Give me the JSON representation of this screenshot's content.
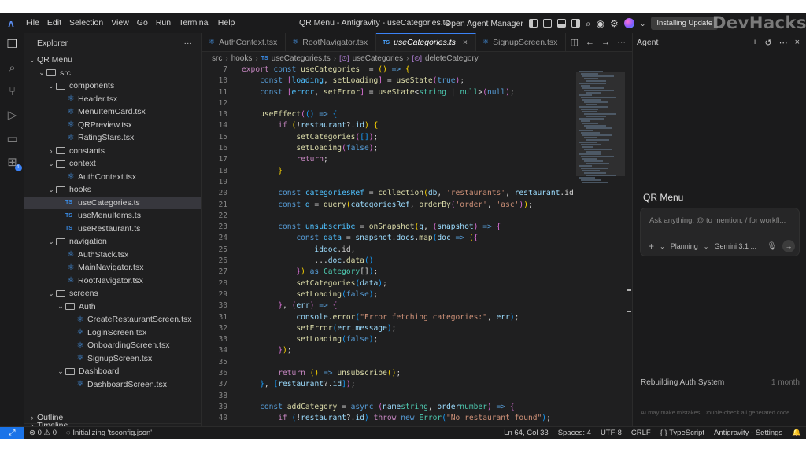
{
  "window": {
    "title": "QR Menu - Antigravity - useCategories.ts",
    "menu": [
      "File",
      "Edit",
      "Selection",
      "View",
      "Go",
      "Run",
      "Terminal",
      "Help"
    ],
    "open_agent_manager": "Open Agent Manager",
    "install_label": "Installing Update",
    "watermark": "DevHacks"
  },
  "activity_icons": [
    "files-icon",
    "search-icon",
    "source-control-icon",
    "run-debug-icon",
    "remote-explorer-icon",
    "extensions-icon"
  ],
  "explorer": {
    "title": "Explorer",
    "more": "···",
    "tree": [
      {
        "label": "QR Menu",
        "depth": 0,
        "type": "folder",
        "open": true
      },
      {
        "label": "src",
        "depth": 1,
        "type": "folder",
        "open": true
      },
      {
        "label": "components",
        "depth": 2,
        "type": "folder",
        "open": true
      },
      {
        "label": "Header.tsx",
        "depth": 3,
        "type": "tsx"
      },
      {
        "label": "MenuItemCard.tsx",
        "depth": 3,
        "type": "tsx"
      },
      {
        "label": "QRPreview.tsx",
        "depth": 3,
        "type": "tsx"
      },
      {
        "label": "RatingStars.tsx",
        "depth": 3,
        "type": "tsx"
      },
      {
        "label": "constants",
        "depth": 2,
        "type": "folder",
        "open": false
      },
      {
        "label": "context",
        "depth": 2,
        "type": "folder",
        "open": true
      },
      {
        "label": "AuthContext.tsx",
        "depth": 3,
        "type": "tsx"
      },
      {
        "label": "hooks",
        "depth": 2,
        "type": "folder",
        "open": true
      },
      {
        "label": "useCategories.ts",
        "depth": 3,
        "type": "ts",
        "selected": true
      },
      {
        "label": "useMenuItems.ts",
        "depth": 3,
        "type": "ts"
      },
      {
        "label": "useRestaurant.ts",
        "depth": 3,
        "type": "ts"
      },
      {
        "label": "navigation",
        "depth": 2,
        "type": "folder",
        "open": true
      },
      {
        "label": "AuthStack.tsx",
        "depth": 3,
        "type": "tsx"
      },
      {
        "label": "MainNavigator.tsx",
        "depth": 3,
        "type": "tsx"
      },
      {
        "label": "RootNavigator.tsx",
        "depth": 3,
        "type": "tsx"
      },
      {
        "label": "screens",
        "depth": 2,
        "type": "folder",
        "open": true
      },
      {
        "label": "Auth",
        "depth": 3,
        "type": "folder",
        "open": true
      },
      {
        "label": "CreateRestaurantScreen.tsx",
        "depth": 4,
        "type": "tsx"
      },
      {
        "label": "LoginScreen.tsx",
        "depth": 4,
        "type": "tsx"
      },
      {
        "label": "OnboardingScreen.tsx",
        "depth": 4,
        "type": "tsx"
      },
      {
        "label": "SignupScreen.tsx",
        "depth": 4,
        "type": "tsx"
      },
      {
        "label": "Dashboard",
        "depth": 3,
        "type": "folder",
        "open": true
      },
      {
        "label": "DashboardScreen.tsx",
        "depth": 4,
        "type": "tsx"
      }
    ],
    "outline": "Outline",
    "timeline": "Timeline"
  },
  "tabs": [
    {
      "label": "AuthContext.tsx",
      "icon": "⚛",
      "active": false
    },
    {
      "label": "RootNavigator.tsx",
      "icon": "⚛",
      "active": false
    },
    {
      "label": "useCategories.ts",
      "icon": "TS",
      "active": true,
      "close": "×"
    },
    {
      "label": "SignupScreen.tsx",
      "icon": "⚛",
      "active": false
    }
  ],
  "breadcrumb": [
    "src",
    "hooks",
    "useCategories.ts",
    "useCategories",
    "deleteCategory"
  ],
  "code": [
    {
      "n": "7",
      "sticky": true,
      "t": [
        [
          "kw2",
          "export "
        ],
        [
          "kw",
          "const "
        ],
        [
          "fn",
          "useCategories"
        ],
        [
          "",
          "  = "
        ],
        [
          "br",
          "()"
        ],
        [
          "kw",
          " => "
        ],
        [
          "br",
          "{"
        ]
      ]
    },
    {
      "n": "10",
      "t": [
        [
          "",
          "    "
        ],
        [
          "kw",
          "const "
        ],
        [
          "br2",
          "["
        ],
        [
          "cn",
          "loading"
        ],
        [
          "",
          ", "
        ],
        [
          "fn",
          "setLoading"
        ],
        [
          "br2",
          "]"
        ],
        [
          "",
          " = "
        ],
        [
          "fn",
          "useState"
        ],
        [
          "br2",
          "("
        ],
        [
          "kw",
          "true"
        ],
        [
          "br2",
          ")"
        ],
        [
          "",
          ";"
        ]
      ]
    },
    {
      "n": "11",
      "t": [
        [
          "",
          "    "
        ],
        [
          "kw",
          "const "
        ],
        [
          "br2",
          "["
        ],
        [
          "cn",
          "error"
        ],
        [
          "",
          ", "
        ],
        [
          "fn",
          "setError"
        ],
        [
          "br2",
          "]"
        ],
        [
          "",
          " = "
        ],
        [
          "fn",
          "useState"
        ],
        [
          "",
          "<"
        ],
        [
          "ty",
          "string"
        ],
        [
          "",
          " | "
        ],
        [
          "ty",
          "null"
        ],
        [
          "",
          ">"
        ],
        [
          "br2",
          "("
        ],
        [
          "kw",
          "null"
        ],
        [
          "br2",
          ")"
        ],
        [
          "",
          ";"
        ]
      ]
    },
    {
      "n": "12",
      "t": []
    },
    {
      "n": "13",
      "t": [
        [
          "",
          "    "
        ],
        [
          "fn",
          "useEffect"
        ],
        [
          "br2",
          "("
        ],
        [
          "br3",
          "()"
        ],
        [
          "kw",
          " => "
        ],
        [
          "br3",
          "{"
        ]
      ]
    },
    {
      "n": "14",
      "t": [
        [
          "",
          "        "
        ],
        [
          "kw2",
          "if "
        ],
        [
          "br",
          "("
        ],
        [
          "",
          "!"
        ],
        [
          "vr",
          "restaurant"
        ],
        [
          "",
          "?."
        ],
        [
          "vr",
          "id"
        ],
        [
          "br",
          ")"
        ],
        [
          "",
          " "
        ],
        [
          "br",
          "{"
        ]
      ]
    },
    {
      "n": "15",
      "t": [
        [
          "",
          "            "
        ],
        [
          "fn",
          "setCategories"
        ],
        [
          "br2",
          "("
        ],
        [
          "br3",
          "[]"
        ],
        [
          "br2",
          ")"
        ],
        [
          "",
          ";"
        ]
      ]
    },
    {
      "n": "16",
      "t": [
        [
          "",
          "            "
        ],
        [
          "fn",
          "setLoading"
        ],
        [
          "br2",
          "("
        ],
        [
          "kw",
          "false"
        ],
        [
          "br2",
          ")"
        ],
        [
          "",
          ";"
        ]
      ]
    },
    {
      "n": "17",
      "t": [
        [
          "",
          "            "
        ],
        [
          "kw2",
          "return"
        ],
        [
          "",
          ";"
        ]
      ]
    },
    {
      "n": "18",
      "t": [
        [
          "",
          "        "
        ],
        [
          "br",
          "}"
        ]
      ]
    },
    {
      "n": "19",
      "t": []
    },
    {
      "n": "20",
      "t": [
        [
          "",
          "        "
        ],
        [
          "kw",
          "const "
        ],
        [
          "cn",
          "categoriesRef"
        ],
        [
          "",
          " = "
        ],
        [
          "fn",
          "collection"
        ],
        [
          "br",
          "("
        ],
        [
          "vr",
          "db"
        ],
        [
          "",
          ", "
        ],
        [
          "str",
          "'restaurants'"
        ],
        [
          "",
          ", "
        ],
        [
          "vr",
          "restaurant"
        ],
        [
          "",
          ".id"
        ]
      ]
    },
    {
      "n": "21",
      "t": [
        [
          "",
          "        "
        ],
        [
          "kw",
          "const "
        ],
        [
          "cn",
          "q"
        ],
        [
          "",
          " = "
        ],
        [
          "fn",
          "query"
        ],
        [
          "br",
          "("
        ],
        [
          "vr",
          "categoriesRef"
        ],
        [
          "",
          ", "
        ],
        [
          "fn",
          "orderBy"
        ],
        [
          "br2",
          "("
        ],
        [
          "str",
          "'order'"
        ],
        [
          "",
          ", "
        ],
        [
          "str",
          "'asc'"
        ],
        [
          "br2",
          ")"
        ],
        [
          "br",
          ")"
        ],
        [
          "",
          ";"
        ]
      ]
    },
    {
      "n": "22",
      "t": []
    },
    {
      "n": "23",
      "t": [
        [
          "",
          "        "
        ],
        [
          "kw",
          "const "
        ],
        [
          "cn",
          "unsubscribe"
        ],
        [
          "",
          " = "
        ],
        [
          "fn",
          "onSnapshot"
        ],
        [
          "br",
          "("
        ],
        [
          "vr",
          "q"
        ],
        [
          "",
          ", "
        ],
        [
          "br2",
          "("
        ],
        [
          "vr",
          "snapshot"
        ],
        [
          "br2",
          ")"
        ],
        [
          "kw",
          " => "
        ],
        [
          "br2",
          "{"
        ]
      ]
    },
    {
      "n": "24",
      "t": [
        [
          "",
          "            "
        ],
        [
          "kw",
          "const "
        ],
        [
          "cn",
          "data"
        ],
        [
          "",
          " = "
        ],
        [
          "vr",
          "snapshot"
        ],
        [
          "",
          "."
        ],
        [
          "vr",
          "docs"
        ],
        [
          "",
          "."
        ],
        [
          "fn",
          "map"
        ],
        [
          "br3",
          "("
        ],
        [
          "vr",
          "doc"
        ],
        [
          "kw",
          " => "
        ],
        [
          "br",
          "("
        ],
        [
          "br2",
          "{"
        ]
      ]
    },
    {
      "n": "25",
      "t": [
        [
          "",
          "                "
        ],
        [
          "vr",
          "id"
        ],
        [
          ": "
        ],
        [
          "vr",
          "doc"
        ],
        [
          "",
          ".id,"
        ]
      ]
    },
    {
      "n": "26",
      "t": [
        [
          "",
          "                ..."
        ],
        [
          "vr",
          "doc"
        ],
        [
          "",
          "."
        ],
        [
          "fn",
          "data"
        ],
        [
          "br3",
          "()"
        ]
      ]
    },
    {
      "n": "27",
      "t": [
        [
          "",
          "            "
        ],
        [
          "br2",
          "}"
        ],
        [
          "br",
          ")"
        ],
        [
          "kw",
          " as "
        ],
        [
          "ty",
          "Category"
        ],
        [
          "",
          "[]"
        ],
        [
          "br3",
          ")"
        ],
        [
          "",
          ";"
        ]
      ]
    },
    {
      "n": "28",
      "t": [
        [
          "",
          "            "
        ],
        [
          "fn",
          "setCategories"
        ],
        [
          "br3",
          "("
        ],
        [
          "vr",
          "data"
        ],
        [
          "br3",
          ")"
        ],
        [
          "",
          ";"
        ]
      ]
    },
    {
      "n": "29",
      "t": [
        [
          "",
          "            "
        ],
        [
          "fn",
          "setLoading"
        ],
        [
          "br3",
          "("
        ],
        [
          "kw",
          "false"
        ],
        [
          "br3",
          ")"
        ],
        [
          "",
          ";"
        ]
      ]
    },
    {
      "n": "30",
      "t": [
        [
          "",
          "        "
        ],
        [
          "br2",
          "}"
        ],
        [
          "",
          ", "
        ],
        [
          "br2",
          "("
        ],
        [
          "vr",
          "err"
        ],
        [
          "br2",
          ")"
        ],
        [
          "kw",
          " => "
        ],
        [
          "br2",
          "{"
        ]
      ]
    },
    {
      "n": "31",
      "t": [
        [
          "",
          "            "
        ],
        [
          "vr",
          "console"
        ],
        [
          "",
          "."
        ],
        [
          "fn",
          "error"
        ],
        [
          "br3",
          "("
        ],
        [
          "str",
          "\"Error fetching categories:\""
        ],
        [
          "",
          ", "
        ],
        [
          "vr",
          "err"
        ],
        [
          "br3",
          ")"
        ],
        [
          "",
          ";"
        ]
      ]
    },
    {
      "n": "32",
      "t": [
        [
          "",
          "            "
        ],
        [
          "fn",
          "setError"
        ],
        [
          "br3",
          "("
        ],
        [
          "vr",
          "err"
        ],
        [
          "",
          "."
        ],
        [
          "vr",
          "message"
        ],
        [
          "br3",
          ")"
        ],
        [
          "",
          ";"
        ]
      ]
    },
    {
      "n": "33",
      "t": [
        [
          "",
          "            "
        ],
        [
          "fn",
          "setLoading"
        ],
        [
          "br3",
          "("
        ],
        [
          "kw",
          "false"
        ],
        [
          "br3",
          ")"
        ],
        [
          "",
          ";"
        ]
      ]
    },
    {
      "n": "34",
      "t": [
        [
          "",
          "        "
        ],
        [
          "br2",
          "}"
        ],
        [
          "br",
          ")"
        ],
        [
          "",
          ";"
        ]
      ]
    },
    {
      "n": "35",
      "t": []
    },
    {
      "n": "36",
      "t": [
        [
          "",
          "        "
        ],
        [
          "kw2",
          "return "
        ],
        [
          "br",
          "()"
        ],
        [
          "kw",
          " => "
        ],
        [
          "fn",
          "unsubscribe"
        ],
        [
          "br",
          "()"
        ],
        [
          "",
          ";"
        ]
      ]
    },
    {
      "n": "37",
      "t": [
        [
          "",
          "    "
        ],
        [
          "br3",
          "}"
        ],
        [
          "",
          ", "
        ],
        [
          "br3",
          "["
        ],
        [
          "vr",
          "restaurant"
        ],
        [
          "",
          "?."
        ],
        [
          "vr",
          "id"
        ],
        [
          "br3",
          "]"
        ],
        [
          "br2",
          ")"
        ],
        [
          "",
          ";"
        ]
      ]
    },
    {
      "n": "38",
      "t": []
    },
    {
      "n": "39",
      "t": [
        [
          "",
          "    "
        ],
        [
          "kw",
          "const "
        ],
        [
          "fn",
          "addCategory"
        ],
        [
          "",
          " = "
        ],
        [
          "kw",
          "async "
        ],
        [
          "br2",
          "("
        ],
        [
          "vr",
          "name"
        ],
        [
          ": "
        ],
        [
          "ty",
          "string"
        ],
        [
          "",
          ", "
        ],
        [
          "vr",
          "order"
        ],
        [
          ": "
        ],
        [
          "ty",
          "number"
        ],
        [
          "br2",
          ")"
        ],
        [
          "kw",
          " => "
        ],
        [
          "br2",
          "{"
        ]
      ]
    },
    {
      "n": "40",
      "t": [
        [
          "",
          "        "
        ],
        [
          "kw2",
          "if "
        ],
        [
          "br3",
          "("
        ],
        [
          "",
          "!"
        ],
        [
          "vr",
          "restaurant"
        ],
        [
          "",
          "?."
        ],
        [
          "vr",
          "id"
        ],
        [
          "br3",
          ")"
        ],
        [
          "",
          " "
        ],
        [
          "kw2",
          "throw "
        ],
        [
          "kw",
          "new "
        ],
        [
          "ty",
          "Error"
        ],
        [
          "br3",
          "("
        ],
        [
          "str",
          "\"No restaurant found\""
        ],
        [
          "br3",
          ")"
        ],
        [
          "",
          ";"
        ]
      ]
    }
  ],
  "agent": {
    "header": "Agent",
    "title": "QR Menu",
    "placeholder": "Ask anything, @ to mention, / for workfl...",
    "mode": "Planning",
    "model": "Gemini 3.1 ...",
    "recent_title": "Rebuilding Auth System",
    "recent_time": "1 month",
    "disclaimer": "AI may make mistakes. Double-check all generated code."
  },
  "status": {
    "errors": "0",
    "warnings": "0",
    "initializing": "Initializing 'tsconfig.json'",
    "position": "Ln 64, Col 33",
    "spaces": "Spaces: 4",
    "encoding": "UTF-8",
    "eol": "CRLF",
    "language": "TypeScript",
    "settings": "Antigravity - Settings"
  }
}
